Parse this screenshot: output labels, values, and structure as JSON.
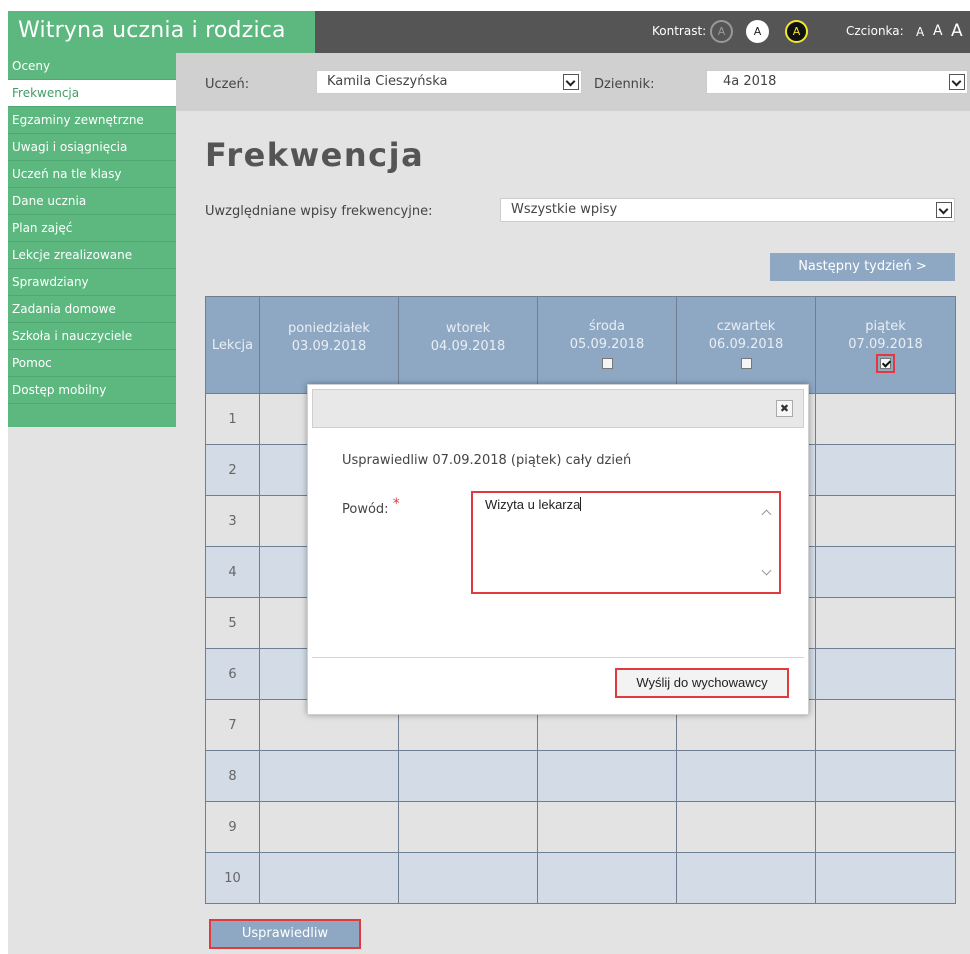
{
  "header": {
    "title": "Witryna ucznia i rodzica",
    "contrast_label": "Kontrast:",
    "contrast_options": [
      "A",
      "A",
      "A"
    ],
    "font_label": "Czcionka:",
    "font_sizes": [
      "A",
      "A",
      "A"
    ]
  },
  "sidebar": {
    "items": [
      {
        "label": "Oceny"
      },
      {
        "label": "Frekwencja",
        "active": true
      },
      {
        "label": "Egzaminy zewnętrzne"
      },
      {
        "label": "Uwagi i osiągnięcia"
      },
      {
        "label": "Uczeń na tle klasy"
      },
      {
        "label": "Dane ucznia"
      },
      {
        "label": "Plan zajęć"
      },
      {
        "label": "Lekcje zrealizowane"
      },
      {
        "label": "Sprawdziany"
      },
      {
        "label": "Zadania domowe"
      },
      {
        "label": "Szkoła i nauczyciele"
      },
      {
        "label": "Pomoc"
      },
      {
        "label": "Dostęp mobilny"
      }
    ]
  },
  "topbar": {
    "student_label": "Uczeń:",
    "student_value": "Kamila Cieszyńska",
    "journal_label": "Dziennik:",
    "journal_value": "4a 2018"
  },
  "main": {
    "title": "Frekwencja",
    "filter_label": "Uwzględniane wpisy frekwencyjne:",
    "filter_value": "Wszystkie wpisy",
    "next_week_label": "Następny tydzień >"
  },
  "table": {
    "lesson_header": "Lekcja",
    "days": [
      {
        "name": "poniedziałek",
        "date": "03.09.2018"
      },
      {
        "name": "wtorek",
        "date": "04.09.2018"
      },
      {
        "name": "środa",
        "date": "05.09.2018"
      },
      {
        "name": "czwartek",
        "date": "06.09.2018"
      },
      {
        "name": "piątek",
        "date": "07.09.2018"
      }
    ],
    "lessons": [
      "1",
      "2",
      "3",
      "4",
      "5",
      "6",
      "7",
      "8",
      "9",
      "10"
    ]
  },
  "justify_button": "Usprawiedliw",
  "modal": {
    "message": "Usprawiedliw 07.09.2018 (piątek) cały dzień",
    "reason_label": "Powód:",
    "required_mark": "*",
    "reason_value": "Wizyta u lekarza",
    "send_label": "Wyślij do wychowawcy",
    "close_glyph": "✖"
  },
  "colors": {
    "brand_green": "#5cb87f",
    "header_dark": "#555555",
    "table_header": "#8ea8c4",
    "highlight_red": "#e0393e"
  }
}
